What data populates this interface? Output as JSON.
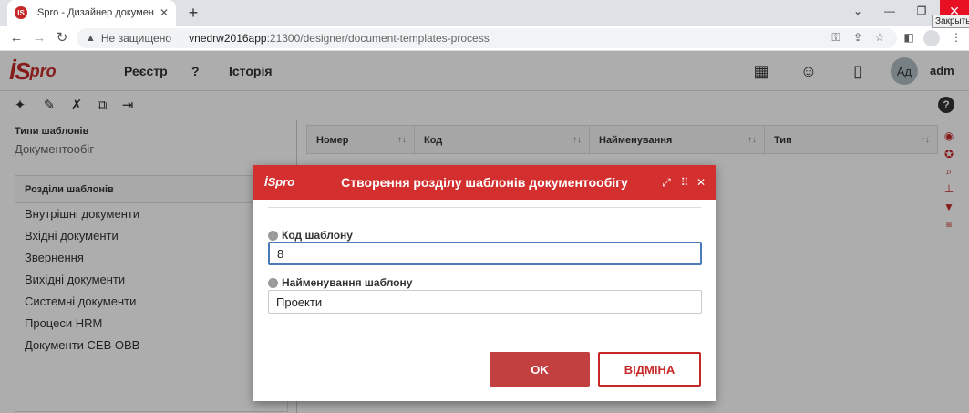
{
  "browser": {
    "tab_title": "ISpro - Дизайнер документів",
    "tab_favicon": "IS",
    "new_tab": "+",
    "close_tooltip": "Закрыть",
    "not_secure": "Не защищено",
    "separator": "|",
    "url_host": "vnedrw2016app",
    "url_path": ":21300/designer/document-templates-process"
  },
  "header": {
    "logo_mark": "İS",
    "logo_text": "pro",
    "menu": [
      "Реєстр",
      "?",
      "Історія"
    ],
    "avatar_initials": "Ад",
    "username": "adm"
  },
  "left_panel": {
    "types_title": "Типи шаблонів",
    "types_value": "Документообіг",
    "sections_header": "Розділи шаблонів",
    "sections": [
      "Внутрішні документи",
      "Вхідні документи",
      "Звернення",
      "Вихідні документи",
      "Системні документи",
      "Процеси HRM",
      "Документи СЕВ ОВВ"
    ]
  },
  "grid": {
    "columns": [
      "Номер",
      "Код",
      "Найменування",
      "Тип"
    ],
    "sort_glyph": "↑↓"
  },
  "dialog": {
    "logo": "İSpro",
    "title": "Створення розділу шаблонів документообігу",
    "code_label": "Код шаблону",
    "code_value": "8",
    "name_label": "Найменування шаблону",
    "name_value": "Проекти",
    "ok_label": "OK",
    "cancel_label": "Відміна"
  },
  "colors": {
    "brand_red": "#d32f2f",
    "ok_button": "#c24040",
    "focus_border": "#4a7ab8"
  }
}
